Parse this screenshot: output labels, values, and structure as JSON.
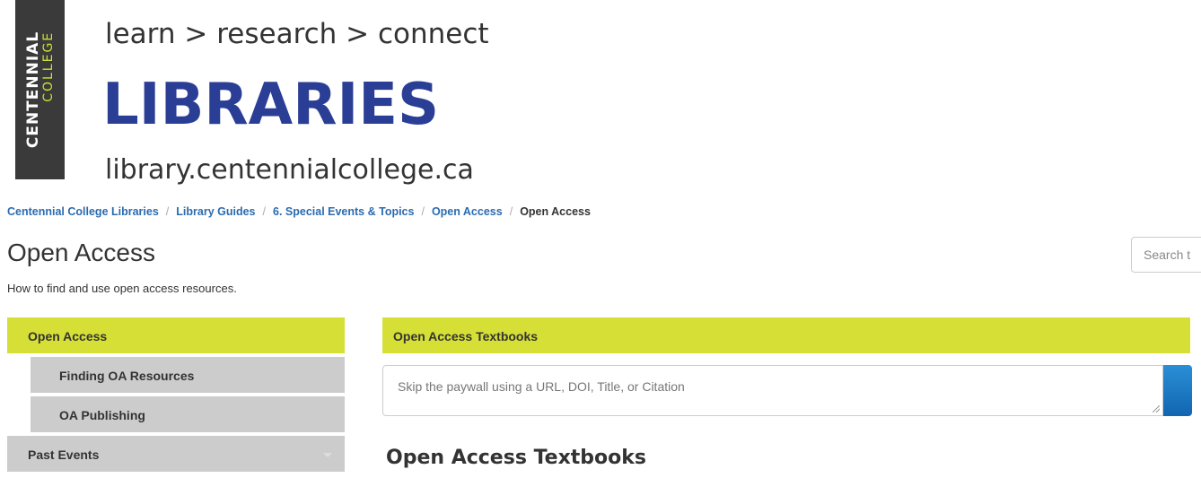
{
  "header": {
    "logo": {
      "word1": "CENTENNIAL",
      "word2": "COLLEGE"
    },
    "tagline": "learn > research > connect",
    "title": "LIBRARIES",
    "url": "library.centennialcollege.ca"
  },
  "breadcrumb": {
    "items": [
      "Centennial College Libraries",
      "Library Guides",
      "6. Special Events & Topics",
      "Open Access"
    ],
    "separator": "/",
    "current": "Open Access"
  },
  "page": {
    "title": "Open Access",
    "description": "How to find and use open access resources."
  },
  "search": {
    "placeholder": "Search t"
  },
  "sidebar": {
    "items": [
      {
        "label": "Open Access"
      },
      {
        "label": "Finding OA Resources"
      },
      {
        "label": "OA Publishing"
      },
      {
        "label": "Past Events"
      }
    ]
  },
  "main": {
    "box_header": "Open Access Textbooks",
    "skip_placeholder": "Skip the paywall using a URL, DOI, Title, or Citation",
    "section_title": "Open Access Textbooks"
  },
  "colors": {
    "accent": "#d5df36",
    "brand_blue": "#2b3e95",
    "link": "#2a6bb0",
    "logo_bg": "#3a3a3a",
    "nav_bg": "#cccccc"
  }
}
